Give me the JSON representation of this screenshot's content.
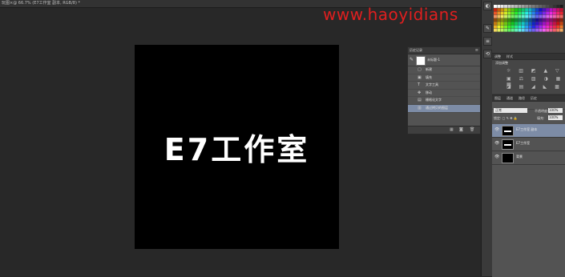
{
  "document_tab": {
    "title": "玩图×@ 66.7% (E7工作室 副本, RGB/8) *"
  },
  "watermark": "www.haoyidians",
  "canvas": {
    "text": "E7工作室"
  },
  "history_panel": {
    "tab": "历史记录",
    "snapshot": "未标题-1",
    "items": [
      "新建",
      "填充",
      "文字工具",
      "移动",
      "栅格化文字",
      "通过拷贝的图层"
    ],
    "active_index": 5
  },
  "adjustments_panel": {
    "tabs": [
      "调整",
      "样式"
    ],
    "title": "添加调整",
    "row1": "☼ ▥ ◩ ▲ ▽",
    "row2": "▣ ⚖ ▨ ◑ ▦ ▦",
    "row3": "◪ ▤ ◢ ◣ ▩"
  },
  "layers_panel": {
    "tabs": [
      "图层",
      "通道",
      "路径",
      "历史"
    ],
    "blend_mode": "正常",
    "opacity_label": "不透明度:",
    "opacity_value": "100%",
    "lock_label": "锁定: ▢ ✎ ✥ 🔒",
    "fill_label": "填充:",
    "fill_value": "100%",
    "layers": [
      {
        "name": "E7工作室 副本",
        "active": true,
        "thumb": "text"
      },
      {
        "name": "E7工作室",
        "active": false,
        "thumb": "text"
      },
      {
        "name": "背景",
        "active": false,
        "thumb": "black"
      }
    ]
  },
  "colors": {
    "workspace": "#282828",
    "canvas": "#000000",
    "watermark": "#e01f1f",
    "active_row": "#7d8ca6"
  }
}
